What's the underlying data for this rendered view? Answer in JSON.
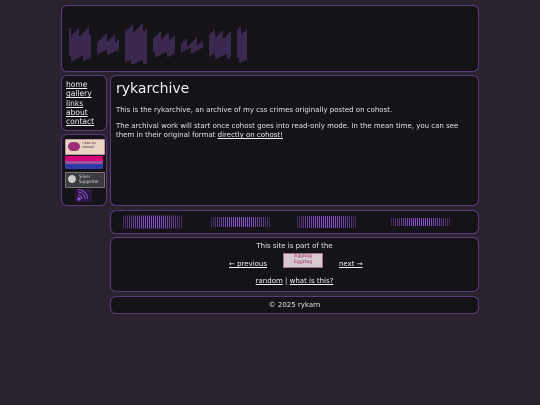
{
  "header": {
    "logo_text": "rykarn"
  },
  "nav": {
    "items": [
      {
        "label": "home"
      },
      {
        "label": "gallery"
      },
      {
        "label": "links"
      },
      {
        "label": "about"
      },
      {
        "label": "contact"
      }
    ]
  },
  "badges": {
    "cohost": "i was on cohost!",
    "silver_line1": "Silver",
    "silver_line2": "Supporter"
  },
  "main": {
    "title": "rykarchive",
    "para1": "This is the rykarchive, an archive of my css crimes originally posted on cohost.",
    "para2": "The archival work will start once cohost goes into read-only mode. In the mean time, you can see them in their original format",
    "para2_link": "directly on cohost!"
  },
  "webring": {
    "intro": "This site is part of the",
    "ring_line1": "Egghug",
    "ring_line2": "Eggring",
    "prev": "← previous",
    "next": "next →",
    "random": "random",
    "separator": "|",
    "what": "what is this?"
  },
  "footer": {
    "copyright": "© 2025 rykarn"
  },
  "colors": {
    "background": "#2b2230",
    "panel": "#151218",
    "border": "#5a3a78",
    "accent": "#8a4fd0"
  }
}
